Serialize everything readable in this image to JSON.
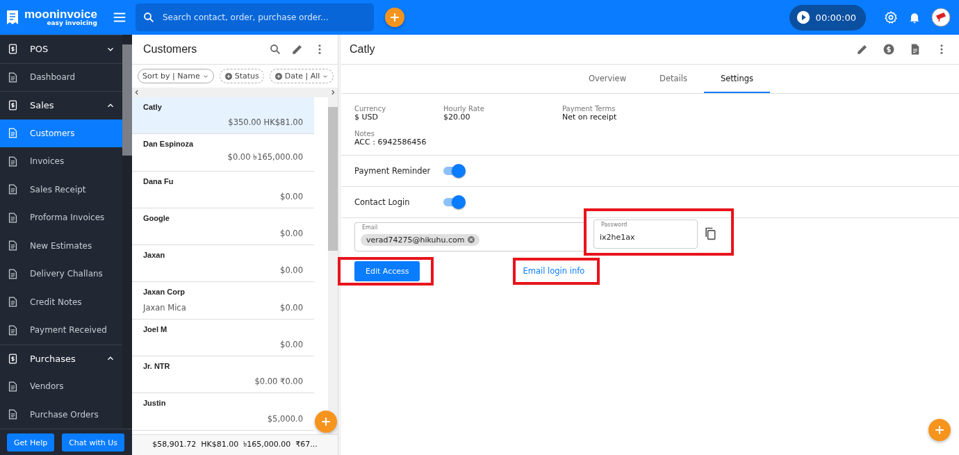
{
  "app": {
    "logo_name": "mooninvoice",
    "logo_tagline": "easy invoicing",
    "search": {
      "placeholder": "Search contact, order, purchase order..."
    },
    "timer": "00:00:00"
  },
  "sidebar": {
    "items": [
      {
        "kind": "section",
        "label": "POS",
        "expanded": false,
        "selected": false
      },
      {
        "kind": "item",
        "label": "Dashboard",
        "selected": false
      },
      {
        "kind": "section",
        "label": "Sales",
        "expanded": true,
        "selected": false
      },
      {
        "kind": "item",
        "label": "Customers",
        "selected": true
      },
      {
        "kind": "item",
        "label": "Invoices",
        "selected": false
      },
      {
        "kind": "item",
        "label": "Sales Receipt",
        "selected": false
      },
      {
        "kind": "item",
        "label": "Proforma Invoices",
        "selected": false
      },
      {
        "kind": "item",
        "label": "New Estimates",
        "selected": false
      },
      {
        "kind": "item",
        "label": "Delivery Challans",
        "selected": false
      },
      {
        "kind": "item",
        "label": "Credit Notes",
        "selected": false
      },
      {
        "kind": "item",
        "label": "Payment Received",
        "selected": false
      },
      {
        "kind": "section",
        "label": "Purchases",
        "expanded": true,
        "selected": false
      },
      {
        "kind": "item",
        "label": "Vendors",
        "selected": false
      },
      {
        "kind": "item",
        "label": "Purchase Orders",
        "selected": false
      }
    ],
    "buttons": [
      "Get Help",
      "Chat with Us"
    ]
  },
  "customers": {
    "title": "Customers",
    "filters": [
      {
        "kind": "sort",
        "label": "Sort by | Name"
      },
      {
        "kind": "add",
        "label": "Status"
      },
      {
        "kind": "add",
        "label": "Date | All"
      }
    ],
    "rows": [
      {
        "name": "Catly",
        "subtitle": "",
        "amount": "$350.00 HK$81.00",
        "selected": true
      },
      {
        "name": "Dan Espinoza",
        "subtitle": "",
        "amount": "$0.00 ৳165,000.00",
        "selected": false
      },
      {
        "name": "Dana Fu",
        "subtitle": "",
        "amount": "$0.00",
        "selected": false
      },
      {
        "name": "Google",
        "subtitle": "",
        "amount": "$0.00",
        "selected": false
      },
      {
        "name": "Jaxan",
        "subtitle": "",
        "amount": "$0.00",
        "selected": false
      },
      {
        "name": "Jaxan Corp",
        "subtitle": "Jaxan Mica",
        "amount": "$0.00",
        "selected": false
      },
      {
        "name": "Joel M",
        "subtitle": "",
        "amount": "$0.00",
        "selected": false
      },
      {
        "name": "Jr. NTR",
        "subtitle": "",
        "amount": "$0.00 ₹0.00",
        "selected": false
      },
      {
        "name": "Justin",
        "subtitle": "",
        "amount": "$5,000.0",
        "selected": false
      }
    ],
    "totals": "$58,901.72  HK$81.00  ৳165,000.00  ₹67..."
  },
  "detail": {
    "title": "Catly",
    "tabs": [
      {
        "label": "Overview",
        "selected": false
      },
      {
        "label": "Details",
        "selected": false
      },
      {
        "label": "Settings",
        "selected": true
      }
    ],
    "fields": [
      {
        "label": "Currency",
        "value": "$ USD"
      },
      {
        "label": "Hourly Rate",
        "value": "$20.00"
      },
      {
        "label": "Payment Terms",
        "value": "Net on receipt"
      }
    ],
    "notes": {
      "label": "Notes",
      "value": "ACC : 6942586456"
    },
    "toggles": [
      {
        "label": "Payment Reminder",
        "on": true
      },
      {
        "label": "Contact Login",
        "on": true
      }
    ],
    "email": {
      "label": "Email",
      "chip": "verad74275@hikuhu.com"
    },
    "password": {
      "label": "Password",
      "value": "ix2he1ax",
      "highlighted": true
    },
    "edit_access": {
      "label": "Edit Access",
      "highlighted": true
    },
    "email_login": {
      "label": "Email login info",
      "highlighted": true
    }
  }
}
